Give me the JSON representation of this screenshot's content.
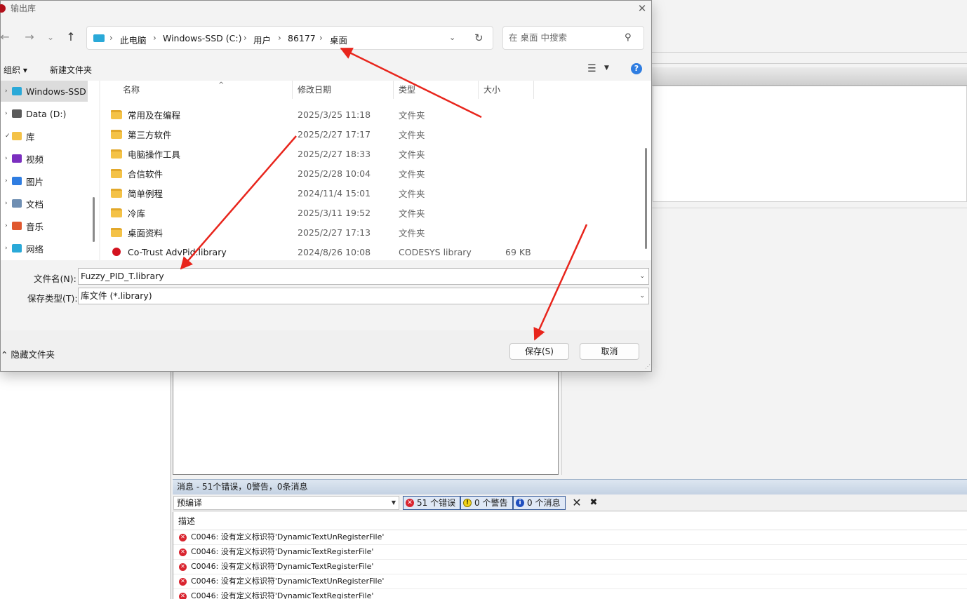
{
  "dialog": {
    "title": "输出库",
    "close": "✕",
    "nav": {
      "back": "←",
      "forward": "→",
      "recent": "⌄",
      "up": "↑"
    },
    "breadcrumbs": [
      "此电脑",
      "Windows-SSD (C:)",
      "用户",
      "86177",
      "桌面"
    ],
    "crumb_sep": "›",
    "search_placeholder": "在 桌面 中搜索",
    "toolbar": {
      "organize": "组织 ▾",
      "new_folder": "新建文件夹"
    },
    "nav_pane": [
      {
        "label": "Windows-SSD",
        "chevron": "›",
        "icon_color": "#2aa9d8",
        "icon": "drive-icon",
        "selected": true
      },
      {
        "label": "Data (D:)",
        "chevron": "›",
        "icon_color": "#5b5b5b",
        "icon": "drive-icon"
      },
      {
        "label": "库",
        "chevron": "✓",
        "icon_color": "#f4c247",
        "icon": "library-icon"
      },
      {
        "label": "视频",
        "chevron": "›",
        "icon_color": "#7b2fbf",
        "icon": "video-icon"
      },
      {
        "label": "图片",
        "chevron": "›",
        "icon_color": "#2f7de1",
        "icon": "picture-icon"
      },
      {
        "label": "文档",
        "chevron": "›",
        "icon_color": "#6f8fb3",
        "icon": "document-icon"
      },
      {
        "label": "音乐",
        "chevron": "›",
        "icon_color": "#e0582f",
        "icon": "music-icon"
      },
      {
        "label": "网络",
        "chevron": "›",
        "icon_color": "#2aa9d8",
        "icon": "network-icon"
      }
    ],
    "columns": [
      "名称",
      "修改日期",
      "类型",
      "大小"
    ],
    "files": [
      {
        "name": "常用及在编程",
        "date": "2025/3/25 11:18",
        "type": "文件夹",
        "size": "",
        "kind": "folder"
      },
      {
        "name": "第三方软件",
        "date": "2025/2/27 17:17",
        "type": "文件夹",
        "size": "",
        "kind": "folder"
      },
      {
        "name": "电脑操作工具",
        "date": "2025/2/27 18:33",
        "type": "文件夹",
        "size": "",
        "kind": "folder"
      },
      {
        "name": "合信软件",
        "date": "2025/2/28 10:04",
        "type": "文件夹",
        "size": "",
        "kind": "folder"
      },
      {
        "name": "简单例程",
        "date": "2024/11/4 15:01",
        "type": "文件夹",
        "size": "",
        "kind": "folder"
      },
      {
        "name": "冷库",
        "date": "2025/3/11 19:52",
        "type": "文件夹",
        "size": "",
        "kind": "folder"
      },
      {
        "name": "桌面资料",
        "date": "2025/2/27 17:13",
        "type": "文件夹",
        "size": "",
        "kind": "folder"
      },
      {
        "name": "Co-Trust AdvPid.library",
        "date": "2024/8/26 10:08",
        "type": "CODESYS library",
        "size": "69 KB",
        "kind": "library"
      }
    ],
    "filename_label": "文件名(N):",
    "filename_value": "Fuzzy_PID_T.library",
    "filetype_label": "保存类型(T):",
    "filetype_value": "库文件 (*.library)",
    "hide_folders": "⌃ 隐藏文件夹",
    "save_button": "保存(S)",
    "cancel_button": "取消"
  },
  "messages": {
    "header": "消息 - 51个错误，0警告，0条消息",
    "source": "预编译",
    "errors": "51 个错误",
    "warnings": "0 个警告",
    "infos": "0 个消息",
    "column": "描述",
    "rows": [
      "C0046: 没有定义标识符'DynamicTextUnRegisterFile'",
      "C0046: 没有定义标识符'DynamicTextRegisterFile'",
      "C0046: 没有定义标识符'DynamicTextRegisterFile'",
      "C0046: 没有定义标识符'DynamicTextUnRegisterFile'",
      "C0046: 没有定义标识符'DynamicTextRegisterFile'"
    ]
  },
  "colors": {
    "accent": "#2f7de1",
    "error": "#d9242f",
    "arrow": "#e8251c"
  }
}
